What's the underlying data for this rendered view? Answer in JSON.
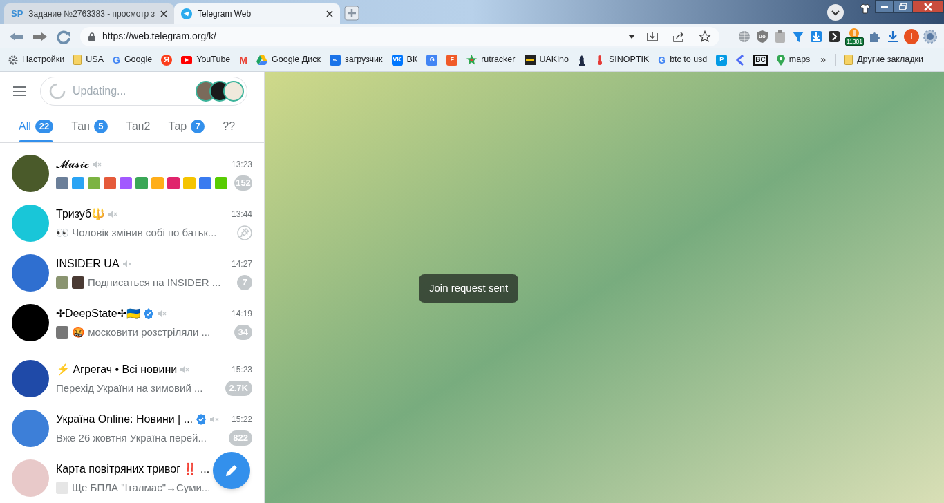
{
  "browser": {
    "tabs": [
      {
        "title": "Задание №2763383 - просмотр з",
        "kind": "text-favicon",
        "glyph": "SP",
        "selected": false
      },
      {
        "title": "Telegram Web",
        "kind": "telegram",
        "selected": true
      }
    ],
    "url": "https://web.telegram.org/k/",
    "extensions": [
      {
        "kind": "globe"
      },
      {
        "kind": "shield",
        "glyph": "uo"
      },
      {
        "kind": "clipboard"
      },
      {
        "kind": "funnel"
      },
      {
        "kind": "download-box"
      },
      {
        "kind": "dark-arrow"
      },
      {
        "kind": "bitcoin",
        "badge": "11301"
      },
      {
        "kind": "puzzle"
      },
      {
        "kind": "download"
      },
      {
        "kind": "profile",
        "glyph": "I"
      },
      {
        "kind": "gear-globe"
      }
    ],
    "bookmarks": [
      {
        "label": "Настройки",
        "kind": "gear",
        "color": "#5f6368"
      },
      {
        "label": "USA",
        "kind": "folder",
        "color": "#f6d365"
      },
      {
        "label": "Google",
        "kind": "letter",
        "glyph": "G",
        "color": "#4285f4"
      },
      {
        "kind": "round",
        "glyph": "Я",
        "color": "#fc3f1d"
      },
      {
        "label": "YouTube",
        "kind": "youtube",
        "color": "#ff0000"
      },
      {
        "kind": "letter",
        "glyph": "M",
        "color": "#ea4335"
      },
      {
        "label": "Google Диск",
        "kind": "drive",
        "color": "#1fa463"
      },
      {
        "label": "загрузчик",
        "kind": "square",
        "glyph": "∞",
        "color": "#1a73e8"
      },
      {
        "label": "ВК",
        "kind": "square",
        "glyph": "VK",
        "color": "#0077ff"
      },
      {
        "kind": "square",
        "glyph": "G",
        "color": "#4285f4"
      },
      {
        "kind": "square",
        "glyph": "F",
        "color": "#f05a28"
      },
      {
        "label": "rutracker",
        "kind": "star",
        "color": "#2fa84f"
      },
      {
        "label": "UAKino",
        "kind": "film",
        "color": "#222222"
      },
      {
        "kind": "knight",
        "color": "#1f2a44"
      },
      {
        "label": "SINOPTIK",
        "kind": "thermometer",
        "color": "#e53935"
      },
      {
        "label": "btc to usd",
        "kind": "letter",
        "glyph": "G",
        "color": "#4285f4"
      },
      {
        "kind": "square",
        "glyph": "P",
        "color": "#039be5"
      },
      {
        "kind": "chevron",
        "color": "#4f6df5"
      },
      {
        "kind": "outline",
        "glyph": "BC",
        "color": "#111111"
      },
      {
        "label": "maps",
        "kind": "pin",
        "color": "#34a853"
      }
    ],
    "more_bookmarks": "»",
    "other_bookmarks": "Другие закладки"
  },
  "telegram": {
    "search": {
      "placeholder": "Updating..."
    },
    "folders": [
      {
        "label": "All",
        "count": "22",
        "selected": true
      },
      {
        "label": "Тап",
        "count": "5",
        "selected": false
      },
      {
        "label": "Тап2",
        "selected": false
      },
      {
        "label": "Тар",
        "count": "7",
        "selected": false
      },
      {
        "label": "??",
        "selected": false
      }
    ],
    "chats": [
      {
        "name": "𝓜𝓾𝓼𝓲𝓬",
        "muted": true,
        "verified": false,
        "time": "13:23",
        "color": "#4a5a2a",
        "thumbs": [
          {
            "color": "#6b7f99"
          },
          {
            "color": "#2aa4f4"
          },
          {
            "color": "#7cb342"
          },
          {
            "color": "#e55a3a"
          },
          {
            "color": "#a259ff"
          },
          {
            "color": "#3aa757"
          },
          {
            "color": "#ffae1a"
          },
          {
            "color": "#e0246c"
          },
          {
            "color": "#f5c400"
          },
          {
            "color": "#3a7bf0"
          },
          {
            "color": "#58cc02"
          }
        ],
        "unread": "152",
        "pinned": false
      },
      {
        "name": "Тризуб🔱",
        "muted": true,
        "verified": false,
        "time": "13:44",
        "color": "#19c6d8",
        "preview": "👀 Чоловік змінив собі по батьк...",
        "pinned": true
      },
      {
        "name": "INSIDER UA",
        "muted": true,
        "verified": false,
        "time": "14:27",
        "color": "#2f6fd0",
        "thumbs": [
          {
            "color": "#8a9470"
          },
          {
            "color": "#4a3a33"
          }
        ],
        "preview": "Подписаться на INSIDER ...",
        "unread": "7",
        "pinned": false
      },
      {
        "name": "✢DeepState✢🇺🇦",
        "muted": true,
        "verified": true,
        "time": "14:19",
        "color": "#000000",
        "thumbs": [
          {
            "color": "#777777"
          }
        ],
        "preview": "🤬 московити розстріляли ...",
        "unread": "34",
        "pinned": false
      },
      {
        "name": "⚡ Агрегач • Всі новини",
        "muted": true,
        "verified": false,
        "time": "15:23",
        "color": "#1f4aa8",
        "preview": "Перехід України на зимовий ...",
        "unread": "2.7K",
        "pinned": false
      },
      {
        "name": "Україна Online: Новини | ...",
        "muted": true,
        "verified": true,
        "time": "15:22",
        "color": "#3d7fd8",
        "preview": "Вже 26 жовтня Україна перей...",
        "unread": "822",
        "pinned": false
      },
      {
        "name": "Карта повітряних тривог ‼️ ...",
        "color": "#e8c9c9",
        "thumbs": [
          {
            "color": "#e6e6e6"
          }
        ],
        "preview": "Ще БПЛА \"Італмас\"→Суми...",
        "pinned": false
      }
    ],
    "toast": "Join request sent"
  }
}
